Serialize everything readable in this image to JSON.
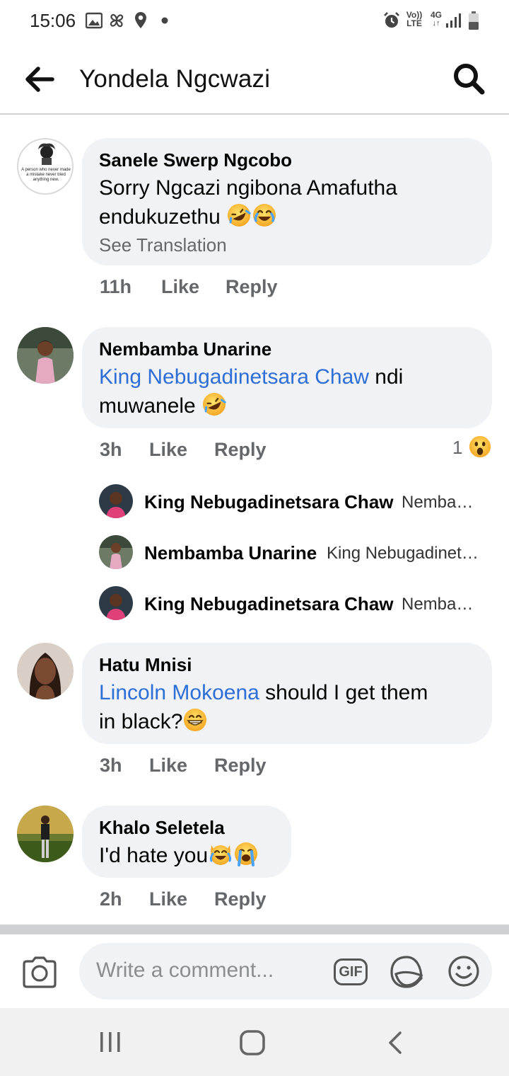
{
  "status_bar": {
    "time": "15:06",
    "left_icons": [
      "gallery-icon",
      "pinwheel-icon",
      "location-icon",
      "dot-icon"
    ],
    "right_icons": [
      "alarm-icon",
      "volte-icon",
      "4g-icon",
      "signal-icon",
      "battery-icon"
    ],
    "volte_label_top": "Vo))",
    "volte_label_bottom": "LTE",
    "net_label": "4G"
  },
  "header": {
    "title": "Yondela Ngcwazi"
  },
  "comments": [
    {
      "name": "Sanele Swerp Ngcobo",
      "avatar_text": "A person who never made a mistake never tried anything new.",
      "text_line1": "Sorry Ngcazi ngibona Amafutha",
      "text_line2": "endukuzethu",
      "emojis": [
        "rolling-laugh-emoji",
        "tears-of-joy-emoji"
      ],
      "see_translation": "See Translation",
      "time": "11h",
      "like": "Like",
      "reply": "Reply"
    },
    {
      "name": "Nembamba Unarine",
      "mention": "King Nebugadinetsara Chaw",
      "text_after_mention": " ndi",
      "text_line2": "muwanele",
      "emojis": [
        "rolling-laugh-emoji"
      ],
      "time": "3h",
      "like": "Like",
      "reply": "Reply",
      "reaction_count": "1",
      "reaction": "wow-emoji",
      "replies": [
        {
          "name": "King Nebugadinetsara Chaw",
          "preview": "Nembamba Unarine"
        },
        {
          "name": "Nembamba Unarine",
          "preview": "King Nebugadinetsara Chaw"
        },
        {
          "name": "King Nebugadinetsara Chaw",
          "preview": "Nembamba Unarine"
        }
      ]
    },
    {
      "name": "Hatu Mnisi",
      "mention": "Lincoln Mokoena",
      "text_after_mention": " should I get them",
      "text_line2": "in black?",
      "emojis": [
        "grin-emoji"
      ],
      "time": "3h",
      "like": "Like",
      "reply": "Reply"
    },
    {
      "name": "Khalo Seletela",
      "text_line1": "I'd hate you",
      "emojis": [
        "laughing-cat-emoji",
        "crying-emoji"
      ],
      "time": "2h",
      "like": "Like",
      "reply": "Reply"
    }
  ],
  "composer": {
    "placeholder": "Write a comment...",
    "gif_label": "GIF",
    "icons": [
      "camera-icon",
      "gif-icon",
      "sticker-icon",
      "emoji-icon"
    ]
  },
  "nav_bar": {
    "icons": [
      "recent-apps-icon",
      "home-icon",
      "back-nav-icon"
    ]
  },
  "colors": {
    "bubble": "#f0f2f5",
    "mention": "#2d6fd6",
    "meta": "#65676b",
    "divider": "#ced0d4",
    "navbar": "#f1f1f1"
  }
}
